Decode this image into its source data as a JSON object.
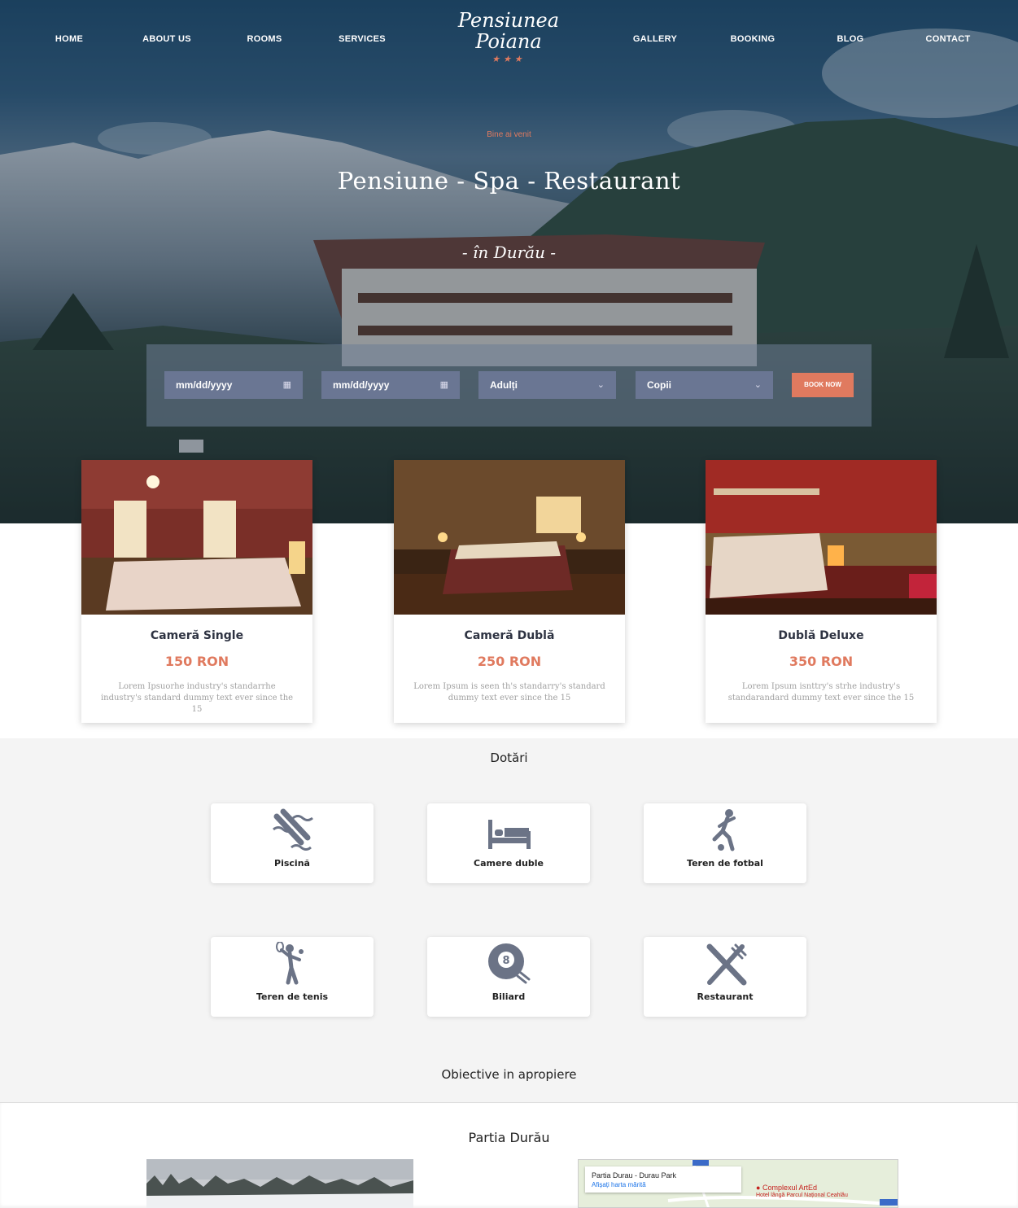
{
  "nav": {
    "left": [
      "HOME",
      "ABOUT US",
      "ROOMS",
      "SERVICES"
    ],
    "right": [
      "GALLERY",
      "BOOKING",
      "BLOG",
      "CONTACT"
    ]
  },
  "logo": {
    "line1": "Pensiunea",
    "line2": "Poiana",
    "stars": "★★★"
  },
  "hero": {
    "welcome": "Bine ai venit",
    "title": "Pensiune - Spa - Restaurant",
    "subtitle": "- în Durău -"
  },
  "booking": {
    "checkin": "mm/dd/yyyy",
    "checkout": "mm/dd/yyyy",
    "adults": "Adulți",
    "children": "Copii",
    "button": "BOOK NOW"
  },
  "rooms": [
    {
      "title": "Cameră Single",
      "price": "150 RON",
      "desc": "Lorem Ipsuorhe industry's standarrhe industry's standard dummy text ever since the 15"
    },
    {
      "title": "Cameră Dublă",
      "price": "250 RON",
      "desc": "Lorem Ipsum is seen th's standarry's standard dummy text ever since the 15"
    },
    {
      "title": "Dublă Deluxe",
      "price": "350 RON",
      "desc": "Lorem Ipsum isnttry's strhe industry's standarandard dummy text ever since the 15"
    }
  ],
  "facilities": {
    "title": "Dotări",
    "items": [
      {
        "label": "Piscină",
        "icon": "pool-icon"
      },
      {
        "label": "Camere duble",
        "icon": "bed-icon"
      },
      {
        "label": "Teren de fotbal",
        "icon": "football-icon"
      },
      {
        "label": "Teren de tenis",
        "icon": "tennis-icon"
      },
      {
        "label": "Biliard",
        "icon": "billiard-icon"
      },
      {
        "label": "Restaurant",
        "icon": "restaurant-icon"
      }
    ]
  },
  "nearby": {
    "title": "Obiective in apropiere",
    "first": "Partia Durău",
    "map_place": "Partia Durau - Durau Park",
    "map_link": "Afișați harta mărită",
    "map_poi": "Complexul ArtEd",
    "map_poi_sub": "Hotel lângă Parcul Național Ceahlău"
  },
  "colors": {
    "accent": "#e07a5f",
    "field": "#6a7693",
    "icon": "#6b7386"
  }
}
